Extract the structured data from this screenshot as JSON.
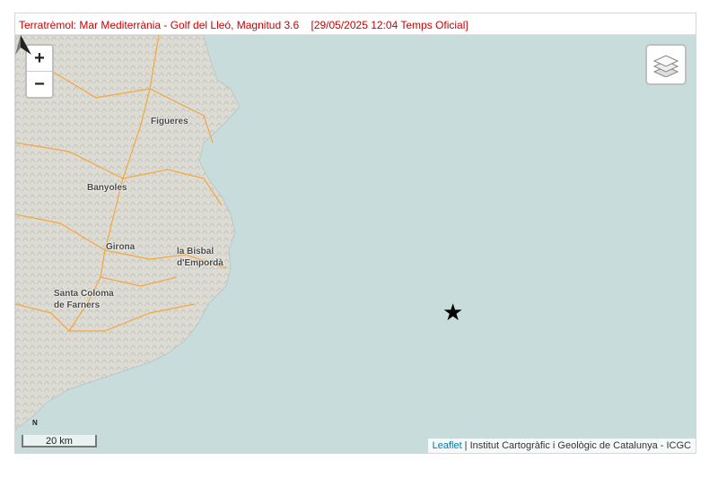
{
  "title": {
    "event": "Terratrèmol: Mar Mediterrània - Golf del Lleó, Magnitud 3.6",
    "datetime": "[29/05/2025 12:04 Temps Oficial]"
  },
  "map": {
    "towns": [
      {
        "name": "Figueres"
      },
      {
        "name": "Banyoles"
      },
      {
        "name": "Girona"
      },
      {
        "name": "la Bisbal"
      },
      {
        "name": "d'Empordà"
      },
      {
        "name": "Santa Coloma"
      },
      {
        "name": "de Farners"
      }
    ],
    "epicenter_icon": "star-icon",
    "sea_color": "#c8dcdc",
    "land_color": "#dcdcd4",
    "road_color": "#f4a640"
  },
  "controls": {
    "zoom_in": "+",
    "zoom_out": "−",
    "layers_icon": "layers-icon",
    "north_label": "N"
  },
  "scale": {
    "label": "20 km"
  },
  "attribution": {
    "leaflet": "Leaflet",
    "separator": " | ",
    "provider": "Institut Cartogràfic i Geològic de Catalunya - ICGC"
  }
}
